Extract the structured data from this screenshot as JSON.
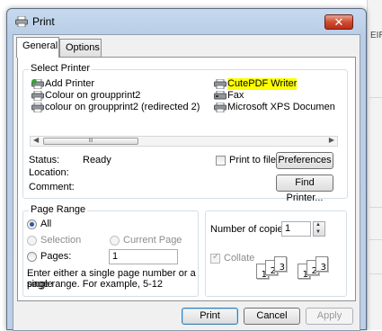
{
  "window": {
    "title": "Print",
    "close_glyph": "✕"
  },
  "background": {
    "edge_text": "EIR"
  },
  "tabs": [
    {
      "label": "General"
    },
    {
      "label": "Options"
    }
  ],
  "select_printer": {
    "group_label": "Select Printer",
    "printers": [
      {
        "label": "Add Printer",
        "icon": "add-printer-icon"
      },
      {
        "label": "Colour on groupprint2",
        "icon": "printer-icon"
      },
      {
        "label": "colour on groupprint2 (redirected 2)",
        "icon": "printer-icon"
      },
      {
        "label": "CutePDF Writer",
        "icon": "printer-icon",
        "highlight": "#ffff00"
      },
      {
        "label": "Fax",
        "icon": "fax-icon"
      },
      {
        "label": "Microsoft XPS Documen",
        "icon": "printer-icon"
      }
    ],
    "scroll": {
      "left_arrow": "◀",
      "right_arrow": "▶",
      "thumb_grip": "III"
    },
    "status_label": "Status:",
    "status_value": "Ready",
    "location_label": "Location:",
    "comment_label": "Comment:",
    "print_to_file_label": "Print to file",
    "print_to_file_checked": false,
    "preferences_label": "Preferences",
    "find_printer_label": "Find Printer..."
  },
  "page_range": {
    "group_label": "Page Range",
    "options": [
      {
        "label": "All",
        "checked": true,
        "enabled": true
      },
      {
        "label": "Selection",
        "checked": false,
        "enabled": false
      },
      {
        "label": "Current Page",
        "checked": false,
        "enabled": false
      },
      {
        "label": "Pages:",
        "checked": false,
        "enabled": true
      }
    ],
    "pages_value": "1",
    "help_line1": "Enter either a single page number or a single",
    "help_line2": "page range.  For example, 5-12"
  },
  "copies": {
    "label": "Number of copies:",
    "value": "1",
    "collate_label": "Collate",
    "collate_checked": true,
    "collate_enabled": false,
    "icon_digits": [
      "1",
      "2",
      "3"
    ]
  },
  "footer": {
    "print_label": "Print",
    "cancel_label": "Cancel",
    "apply_label": "Apply"
  },
  "colors": {
    "highlight": "#ffff00",
    "close_button": "#cf4d33",
    "title_bar": "#c6d9ef"
  }
}
